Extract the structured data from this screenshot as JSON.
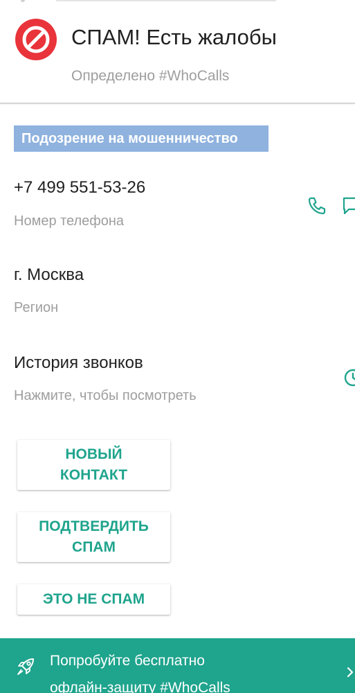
{
  "header": {
    "title": "СПАМ! Есть жалобы",
    "subtitle": "Определено #WhoCalls"
  },
  "badge": {
    "label": "Подозрение на мошенничество"
  },
  "phone": {
    "value": "+7 499 551-53-26",
    "label": "Номер телефона"
  },
  "region": {
    "value": "г. Москва",
    "label": "Регион"
  },
  "history": {
    "value": "История звонков",
    "label": "Нажмите, чтобы посмотреть"
  },
  "buttons": {
    "new_contact": "НОВЫЙ\nКОНТАКТ",
    "confirm_spam": "ПОДТВЕРДИТЬ\nСПАМ",
    "not_spam": "ЭТО НЕ СПАМ"
  },
  "promo": {
    "text": "Попробуйте бесплатно\nофлайн-защиту #WhoCalls"
  },
  "icons": {
    "spam": "block-icon",
    "call": "phone-icon",
    "message": "message-icon",
    "history": "clock-icon",
    "promo": "rocket-icon",
    "chevron": "chevron-right-icon"
  },
  "colors": {
    "spam_red": "#e8343a",
    "accent_teal": "#1fa48d",
    "badge_blue": "#8fb2de"
  }
}
